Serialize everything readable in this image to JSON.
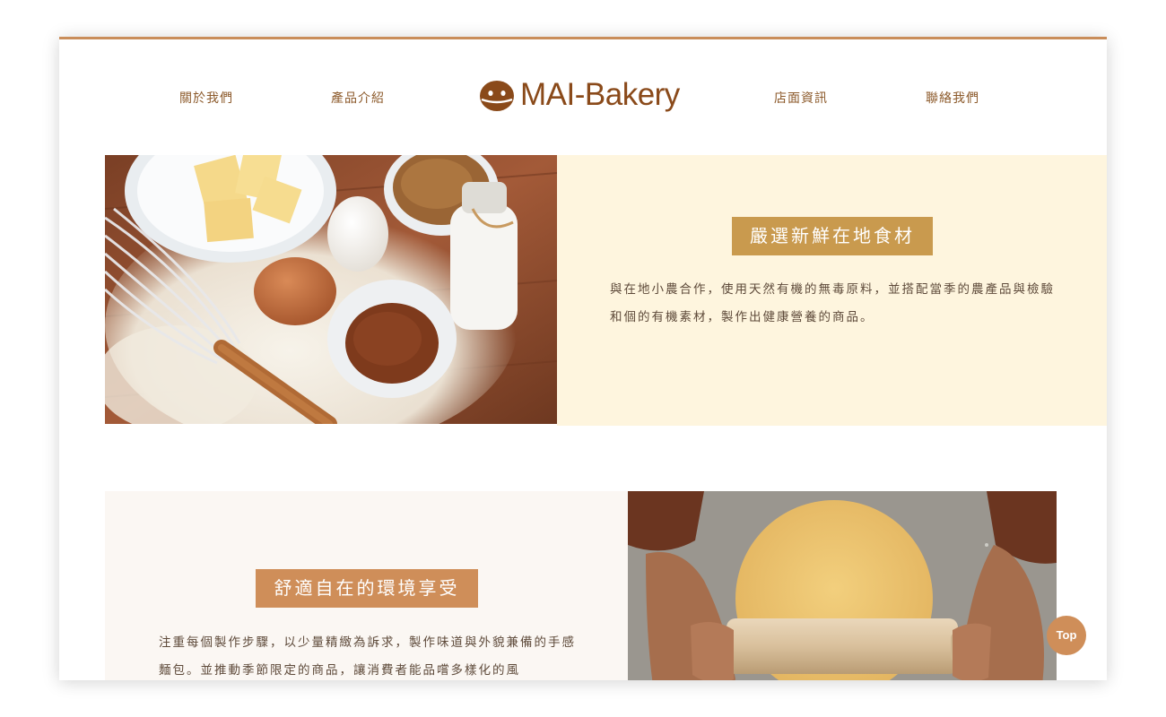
{
  "nav": {
    "about": "關於我們",
    "products": "產品介紹",
    "store": "店面資訊",
    "contact": "聯絡我們"
  },
  "logo": {
    "text": "MAI-Bakery",
    "color": "#8a4a1a"
  },
  "section1": {
    "title": "嚴選新鮮在地食材",
    "body": "與在地小農合作，使用天然有機的無毒原料，並搭配當季的農產品與檢驗和個的有機素材，製作出健康營養的商品。",
    "image_alt": "baking ingredients"
  },
  "section2": {
    "title": "舒適自在的環境享受",
    "body": "注重每個製作步驟，以少量精緻為訴求，製作味道與外貌兼備的手感麵包。並推動季節限定的商品，讓消費者能品嚐多樣化的風",
    "image_alt": "rolling dough"
  },
  "top_button": "Top",
  "colors": {
    "accent_bar": "#c98d5a",
    "panel1_bg": "#fef5de",
    "panel2_bg": "#fbf7f3",
    "badge1": "#c99a4e",
    "badge2": "#cf8e59",
    "nav_text": "#8c5a2b"
  }
}
